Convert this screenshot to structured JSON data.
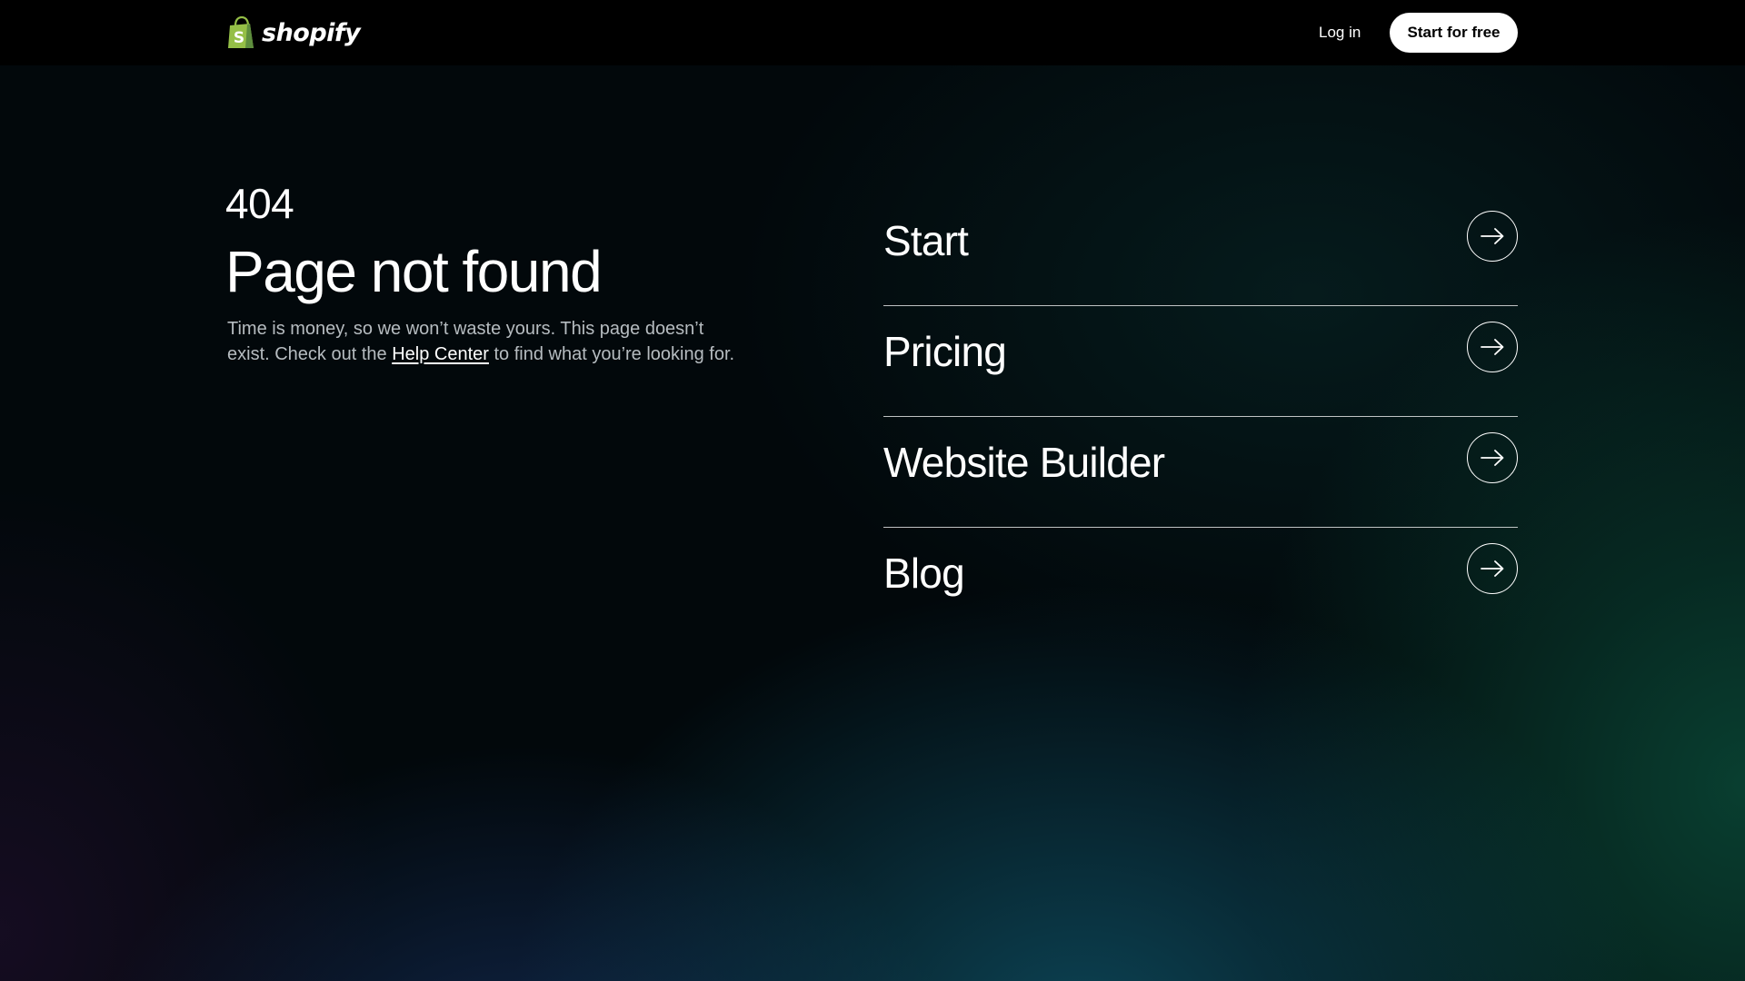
{
  "header": {
    "logo_text": "shopify",
    "login_label": "Log in",
    "cta_label": "Start for free"
  },
  "error": {
    "code": "404",
    "title": "Page not found",
    "desc_before": "Time is money, so we won’t waste yours. This page doesn’t exist. Check out the ",
    "help_link": "Help Center",
    "desc_after": " to find what you’re looking for."
  },
  "links": [
    {
      "label": "Start",
      "icon": "arrow-right-icon"
    },
    {
      "label": "Pricing",
      "icon": "arrow-right-icon"
    },
    {
      "label": "Website Builder",
      "icon": "arrow-right-icon"
    },
    {
      "label": "Blog",
      "icon": "arrow-right-icon"
    }
  ],
  "colors": {
    "topbar": "#000000",
    "brand_green": "#95bf47",
    "brand_green_dark": "#5e8e3e",
    "text": "#ffffff",
    "muted_text": "#b6bcc0"
  }
}
